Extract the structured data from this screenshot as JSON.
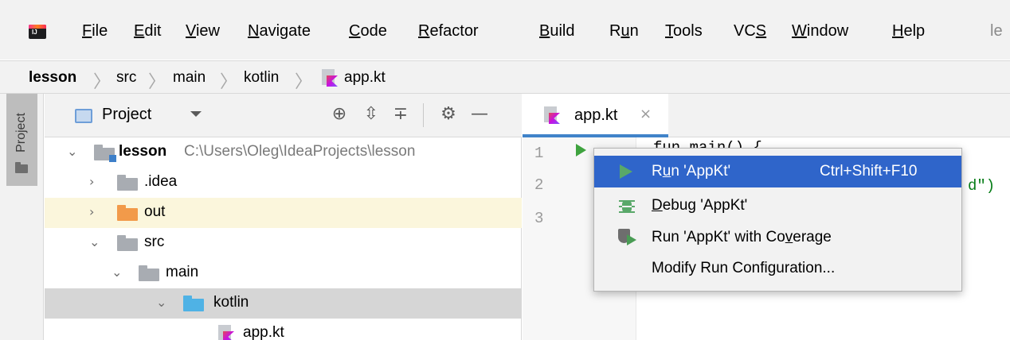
{
  "menu": {
    "items": [
      {
        "label": "File",
        "mnemonic": "F",
        "rest": "ile"
      },
      {
        "label": "Edit",
        "mnemonic": "E",
        "rest": "dit"
      },
      {
        "label": "View",
        "mnemonic": "V",
        "rest": "iew"
      },
      {
        "label": "Navigate",
        "mnemonic": "N",
        "rest": "avigate"
      },
      {
        "label": "Code",
        "mnemonic": "C",
        "rest": "ode"
      },
      {
        "label": "Refactor",
        "mnemonic": "R",
        "rest": "efactor"
      },
      {
        "label": "Build",
        "mnemonic": "B",
        "rest": "uild"
      },
      {
        "label": "Run",
        "before": "R",
        "mnemonic": "u",
        "rest": "n"
      },
      {
        "label": "Tools",
        "mnemonic": "T",
        "rest": "ools"
      },
      {
        "label": "VCS",
        "before": "VC",
        "mnemonic": "S",
        "rest": ""
      },
      {
        "label": "Window",
        "mnemonic": "W",
        "rest": "indow"
      },
      {
        "label": "Help",
        "mnemonic": "H",
        "rest": "elp"
      }
    ],
    "overflow_text": "le"
  },
  "breadcrumb": {
    "items": [
      "lesson",
      "src",
      "main",
      "kotlin",
      "app.kt"
    ]
  },
  "stripe": {
    "project_label": "Project"
  },
  "project_panel": {
    "title": "Project",
    "toolbar_icons": [
      "locate-icon",
      "expand-all-icon",
      "collapse-all-icon",
      "gear-icon",
      "hide-icon"
    ]
  },
  "tree": [
    {
      "label": "lesson",
      "path": "C:\\Users\\Oleg\\IdeaProjects\\lesson",
      "expanded": true,
      "type": "module"
    },
    {
      "label": ".idea",
      "expanded": false,
      "type": "folder"
    },
    {
      "label": "out",
      "expanded": false,
      "type": "excluded-folder"
    },
    {
      "label": "src",
      "expanded": true,
      "type": "folder"
    },
    {
      "label": "main",
      "expanded": true,
      "type": "folder"
    },
    {
      "label": "kotlin",
      "expanded": true,
      "type": "source-folder",
      "selected": true
    },
    {
      "label": "app.kt",
      "type": "kotlin-file"
    }
  ],
  "editor": {
    "tab": {
      "label": "app.kt",
      "close": "×"
    },
    "line_numbers": [
      "1",
      "2",
      "3"
    ],
    "code_fragments": {
      "line1": "fun main() {",
      "line2_tail": "d\")"
    }
  },
  "popup": {
    "items": [
      {
        "label": "Run 'AppKt'",
        "before": "R",
        "mnemonic": "u",
        "rest": "n 'AppKt'",
        "shortcut": "Ctrl+Shift+F10",
        "icon": "run-icon",
        "selected": true
      },
      {
        "label": "Debug 'AppKt'",
        "before": "",
        "mnemonic": "D",
        "rest": "ebug 'AppKt'",
        "shortcut": "",
        "icon": "debug-icon",
        "selected": false
      },
      {
        "label": "Run 'AppKt' with Coverage",
        "before": "Run 'AppKt' with Co",
        "mnemonic": "v",
        "rest": "erage",
        "shortcut": "",
        "icon": "coverage-icon",
        "selected": false
      },
      {
        "label": "Modify Run Configuration...",
        "before": "Modify Run Configuration...",
        "mnemonic": "",
        "rest": "",
        "shortcut": "",
        "icon": "",
        "selected": false
      }
    ]
  },
  "colors": {
    "selection": "#2f65ca",
    "run_green": "#499c54",
    "tab_underline": "#4083c9",
    "excluded_folder": "#f29a4a",
    "source_folder": "#4fb2e5"
  }
}
